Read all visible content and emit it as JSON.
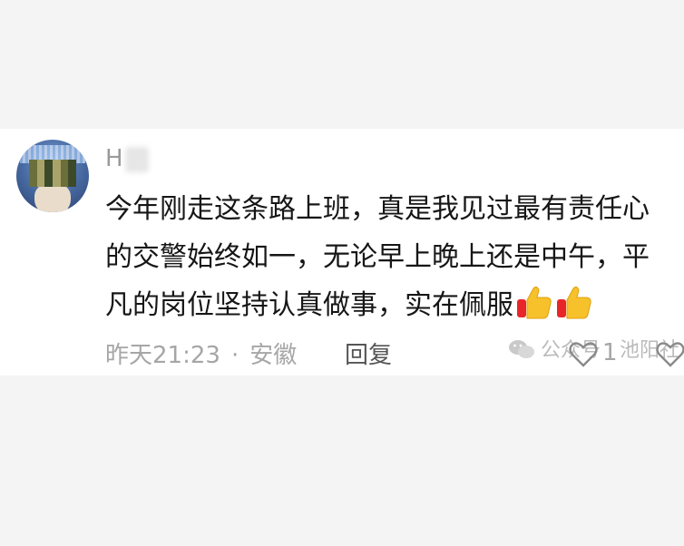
{
  "comment": {
    "username": "H",
    "lines": [
      "今年刚走这条路上班，真是我见过最有责任心",
      "的交警始终如一，无论早上晚上还是中午，平",
      "凡的岗位坚持认真做事，实在佩服"
    ],
    "emojis": [
      "thumbs-up",
      "thumbs-up"
    ],
    "time": "昨天21:23",
    "separator": "·",
    "location": "安徽",
    "reply_label": "回复",
    "like_count": "1"
  },
  "watermark": {
    "text": "公众号 · 池阳社"
  },
  "colors": {
    "background": "#f4f4f4",
    "card": "#ffffff",
    "text": "#161616",
    "meta": "#a6a6a6",
    "username": "#9a9a9a"
  }
}
